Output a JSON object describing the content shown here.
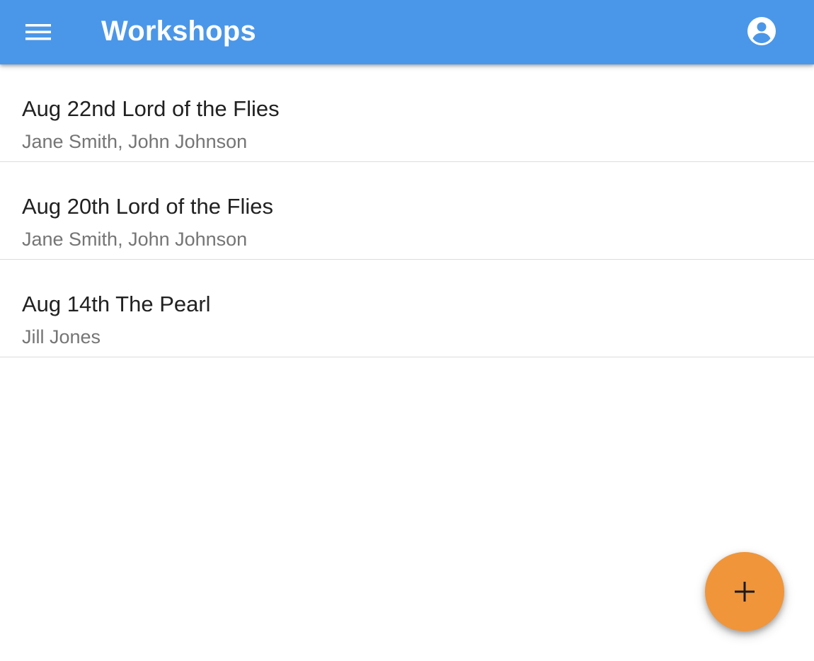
{
  "app_bar": {
    "title": "Workshops",
    "background_color": "#4a97e9",
    "menu_icon": "menu-icon",
    "account_icon": "account-circle-icon"
  },
  "workshops": [
    {
      "title": "Aug 22nd Lord of the Flies",
      "participants": "Jane Smith, John Johnson"
    },
    {
      "title": "Aug 20th Lord of the Flies",
      "participants": "Jane Smith, John Johnson"
    },
    {
      "title": "Aug 14th The Pearl",
      "participants": "Jill Jones"
    }
  ],
  "fab": {
    "icon": "add-icon",
    "background_color": "#f0953a"
  }
}
